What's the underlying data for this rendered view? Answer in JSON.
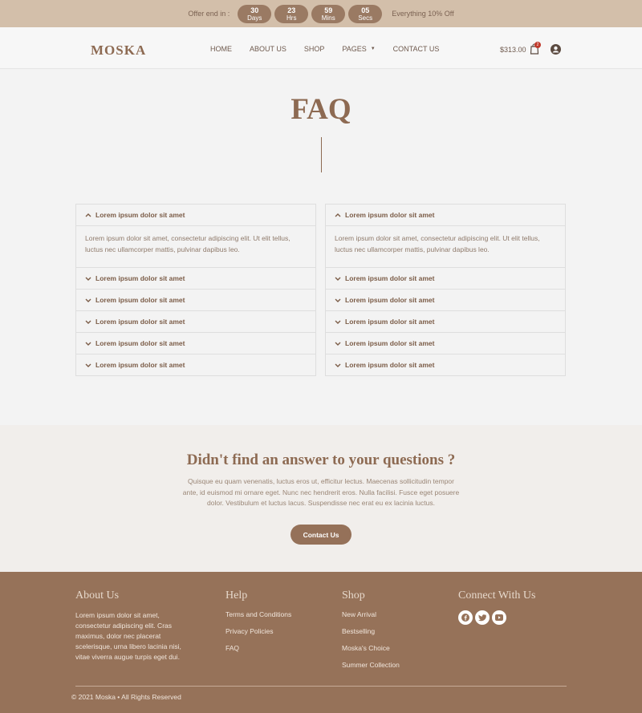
{
  "offer": {
    "label": "Offer end in :",
    "countdown": [
      {
        "num": "30",
        "unit": "Days"
      },
      {
        "num": "23",
        "unit": "Hrs"
      },
      {
        "num": "59",
        "unit": "Mins"
      },
      {
        "num": "05",
        "unit": "Secs"
      }
    ],
    "promo": "Everything 10% Off"
  },
  "header": {
    "logo": "MOSKA",
    "nav": [
      "HOME",
      "ABOUT US",
      "SHOP",
      "PAGES",
      "CONTACT US"
    ],
    "cart_amount": "$313.00",
    "cart_count": "2"
  },
  "page": {
    "title": "FAQ"
  },
  "faq": {
    "left": [
      {
        "q": "Lorem ipsum dolor sit amet",
        "a": "Lorem ipsum dolor sit amet, consectetur adipiscing elit. Ut elit tellus, luctus nec ullamcorper mattis, pulvinar dapibus leo.",
        "open": true
      },
      {
        "q": "Lorem ipsum dolor sit amet",
        "open": false
      },
      {
        "q": "Lorem ipsum dolor sit amet",
        "open": false
      },
      {
        "q": "Lorem ipsum dolor sit amet",
        "open": false
      },
      {
        "q": "Lorem ipsum dolor sit amet",
        "open": false
      },
      {
        "q": "Lorem ipsum dolor sit amet",
        "open": false
      }
    ],
    "right": [
      {
        "q": "Lorem ipsum dolor sit amet",
        "a": "Lorem ipsum dolor sit amet, consectetur adipiscing elit. Ut elit tellus, luctus nec ullamcorper mattis, pulvinar dapibus leo.",
        "open": true
      },
      {
        "q": "Lorem ipsum dolor sit amet",
        "open": false
      },
      {
        "q": "Lorem ipsum dolor sit amet",
        "open": false
      },
      {
        "q": "Lorem ipsum dolor sit amet",
        "open": false
      },
      {
        "q": "Lorem ipsum dolor sit amet",
        "open": false
      },
      {
        "q": "Lorem ipsum dolor sit amet",
        "open": false
      }
    ]
  },
  "cta": {
    "title": "Didn't find an answer to your questions ?",
    "text": "Quisque eu quam venenatis, luctus eros ut, efficitur lectus. Maecenas sollicitudin tempor ante, id euismod mi ornare eget. Nunc nec hendrerit eros. Nulla facilisi. Fusce eget posuere dolor. Vestibulum et luctus lacus. Suspendisse nec erat eu ex lacinia luctus.",
    "button": "Contact Us"
  },
  "footer": {
    "about": {
      "title": "About Us",
      "text": "Lorem ipsum dolor sit amet, consectetur adipiscing elit. Cras maximus, dolor nec placerat scelerisque, urna libero lacinia nisi, vitae viverra augue turpis eget dui."
    },
    "help": {
      "title": "Help",
      "links": [
        "Terms and Conditions",
        "Privacy Policies",
        "FAQ"
      ]
    },
    "shop": {
      "title": "Shop",
      "links": [
        "New Arrival",
        "Bestselling",
        "Moska's Choice",
        "Summer Collection"
      ]
    },
    "connect": {
      "title": "Connect With Us",
      "icons": [
        "facebook-icon",
        "twitter-icon",
        "youtube-icon"
      ]
    },
    "copyright": "© 2021 Moska • All Rights Reserved"
  },
  "colors": {
    "accent": "#967259",
    "offer_bar": "#d3bfaa",
    "badge": "#c0392b"
  }
}
